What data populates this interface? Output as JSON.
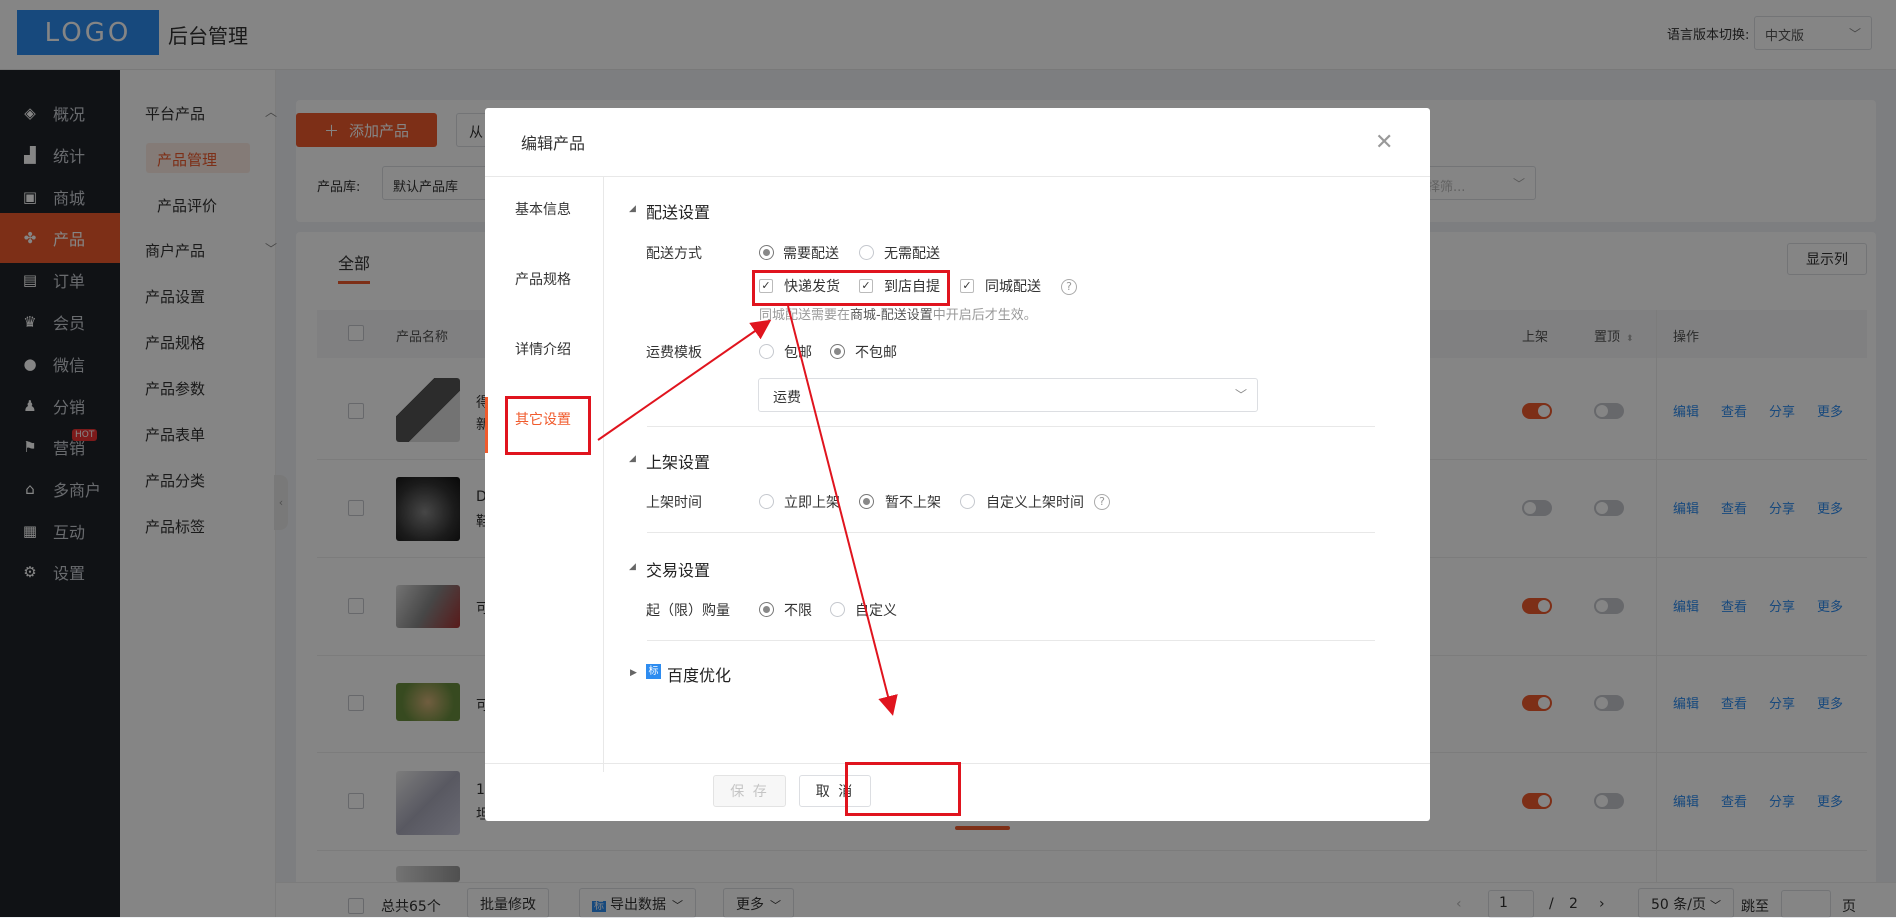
{
  "app": {
    "logo": "LOGO",
    "title": "后台管理",
    "lang_label": "语言版本切换:",
    "lang_value": "中文版"
  },
  "sidebar": {
    "items": [
      {
        "label": "概况",
        "icon": "layers-icon"
      },
      {
        "label": "统计",
        "icon": "chart-icon"
      },
      {
        "label": "商城",
        "icon": "mail-icon"
      },
      {
        "label": "产品",
        "icon": "apps-icon"
      },
      {
        "label": "订单",
        "icon": "clipboard-icon"
      },
      {
        "label": "会员",
        "icon": "crown-icon"
      },
      {
        "label": "微信",
        "icon": "chat-icon"
      },
      {
        "label": "分销",
        "icon": "user-icon"
      },
      {
        "label": "营销",
        "icon": "flag-icon"
      },
      {
        "label": "多商户",
        "icon": "store-icon"
      },
      {
        "label": "互动",
        "icon": "grid-icon"
      },
      {
        "label": "设置",
        "icon": "gear-icon"
      }
    ],
    "hot_badge": "HOT"
  },
  "subnav": {
    "items": [
      "平台产品",
      "产品管理",
      "产品评价",
      "商户产品",
      "产品设置",
      "产品规格",
      "产品参数",
      "产品表单",
      "产品分类",
      "产品标签"
    ]
  },
  "toolbar": {
    "add_label": "添加产品",
    "from_label": "从",
    "lib_label": "产品库:",
    "lib_value": "默认产品库",
    "filter_placeholder": "请选择筛..."
  },
  "table": {
    "tab_all": "全部",
    "columns_button": "显示列",
    "headers": {
      "name": "产品名称",
      "shelf": "上架",
      "top": "置顶",
      "ops": "操作"
    },
    "row_text": [
      [
        "得",
        "新"
      ],
      [
        "D",
        "鞋"
      ],
      [
        "可",
        ""
      ],
      [
        "可",
        ""
      ],
      [
        "1",
        "坦"
      ]
    ],
    "shelf_on": [
      true,
      false,
      true,
      true,
      true
    ],
    "ops": [
      "编辑",
      "查看",
      "分享",
      "更多"
    ]
  },
  "footer": {
    "total": "总共65个",
    "batch": "批量修改",
    "export": "导出数据",
    "more": "更多",
    "page": "1",
    "sep": "/",
    "pages": "2",
    "per_page": "50 条/页",
    "goto": "跳至",
    "page_unit": "页"
  },
  "modal": {
    "title": "编辑产品",
    "tabs": [
      "基本信息",
      "产品规格",
      "详情介绍",
      "其它设置"
    ],
    "delivery": {
      "section": "配送设置",
      "method_label": "配送方式",
      "need": "需要配送",
      "no_need": "无需配送",
      "express": "快递发货",
      "pickup": "到店自提",
      "city": "同城配送",
      "hint_pre": "同城配送需要在",
      "hint_link": "商城-配送设置",
      "hint_post": "中开启后才生效。",
      "freight_label": "运费模板",
      "free": "包邮",
      "not_free": "不包邮",
      "freight_value": "运费"
    },
    "shelf": {
      "section": "上架设置",
      "time_label": "上架时间",
      "now": "立即上架",
      "not_yet": "暂不上架",
      "custom": "自定义上架时间"
    },
    "trade": {
      "section": "交易设置",
      "limit_label": "起（限）购量",
      "unlimited": "不限",
      "custom": "自定义"
    },
    "seo": {
      "section": "百度优化",
      "icon_text": "标"
    },
    "save": "保 存",
    "cancel": "取 消"
  }
}
